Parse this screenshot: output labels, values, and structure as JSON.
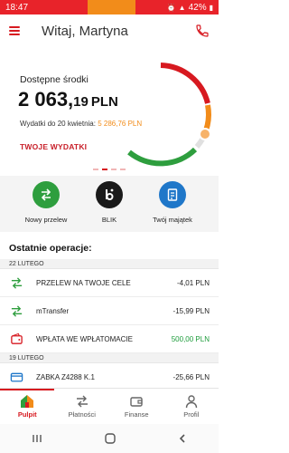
{
  "status_bar": {
    "time": "18:47",
    "battery": "42%"
  },
  "header": {
    "greeting": "Witaj, Martyna"
  },
  "balance": {
    "label": "Dostępne środki",
    "amount_main": "2 063,",
    "amount_cents": "19",
    "currency": "PLN",
    "spend_label": "Wydatki do 20 kwietnia:",
    "spend_value": "5 286,76 PLN",
    "your_spending": "TWOJE WYDATKI"
  },
  "actions": [
    {
      "label": "Nowy przelew",
      "color": "#2e9e3e",
      "icon": "transfer-arrows-icon"
    },
    {
      "label": "BLIK",
      "color": "#1a1a1a",
      "icon": "blik-icon"
    },
    {
      "label": "Twój majątek",
      "color": "#1f77c9",
      "icon": "wealth-document-icon"
    }
  ],
  "operations": {
    "title": "Ostatnie operacje:",
    "groups": [
      {
        "date": "22 LUTEGO",
        "items": [
          {
            "name": "PRZELEW NA TWOJE CELE",
            "amount": "-4,01 PLN",
            "icon": "transfer-arrows-icon"
          },
          {
            "name": "mTransfer",
            "amount": "-15,99 PLN",
            "icon": "transfer-arrows-icon"
          },
          {
            "name": "WPŁATA WE WPŁATOMACIE",
            "amount": "500,00 PLN",
            "icon": "wallet-icon"
          }
        ]
      },
      {
        "date": "19 LUTEGO",
        "items": [
          {
            "name": "ZABKA Z4288 K.1",
            "amount": "-25,66 PLN",
            "icon": "card-icon"
          }
        ]
      }
    ]
  },
  "bottom_nav": [
    {
      "label": "Pulpit",
      "icon": "home-icon"
    },
    {
      "label": "Płatności",
      "icon": "payments-icon"
    },
    {
      "label": "Finanse",
      "icon": "finance-wallet-icon"
    },
    {
      "label": "Profil",
      "icon": "profile-icon"
    }
  ],
  "colors": {
    "brand": "#d71920",
    "accent_orange": "#f28c1a",
    "green": "#2e9e3e",
    "blue": "#1f77c9"
  }
}
